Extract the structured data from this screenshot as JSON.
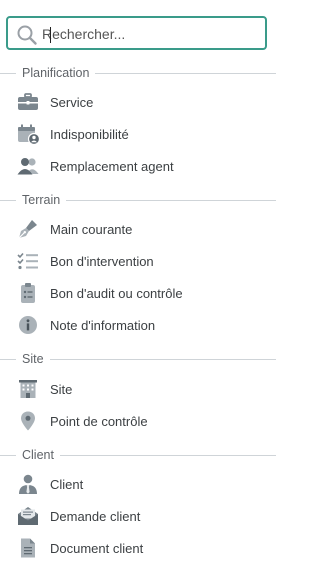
{
  "search": {
    "placeholder": "Rechercher...",
    "value": ""
  },
  "sections": [
    {
      "title": "Planification",
      "items": [
        {
          "label": "Service",
          "icon": "briefcase-icon"
        },
        {
          "label": "Indisponibilité",
          "icon": "calendar-user-icon"
        },
        {
          "label": "Remplacement agent",
          "icon": "users-icon"
        }
      ]
    },
    {
      "title": "Terrain",
      "items": [
        {
          "label": "Main courante",
          "icon": "pen-nib-icon"
        },
        {
          "label": "Bon d'intervention",
          "icon": "checklist-icon"
        },
        {
          "label": "Bon d'audit ou contrôle",
          "icon": "clipboard-icon"
        },
        {
          "label": "Note d'information",
          "icon": "info-icon"
        }
      ]
    },
    {
      "title": "Site",
      "items": [
        {
          "label": "Site",
          "icon": "building-icon"
        },
        {
          "label": "Point de contrôle",
          "icon": "map-pin-icon"
        }
      ]
    },
    {
      "title": "Client",
      "items": [
        {
          "label": "Client",
          "icon": "user-tie-icon"
        },
        {
          "label": "Demande client",
          "icon": "envelope-open-icon"
        },
        {
          "label": "Document client",
          "icon": "document-icon"
        }
      ]
    }
  ],
  "colors": {
    "accent": "#3a9b8a",
    "icon": "#7b868e",
    "divider": "#cfd4d8"
  }
}
